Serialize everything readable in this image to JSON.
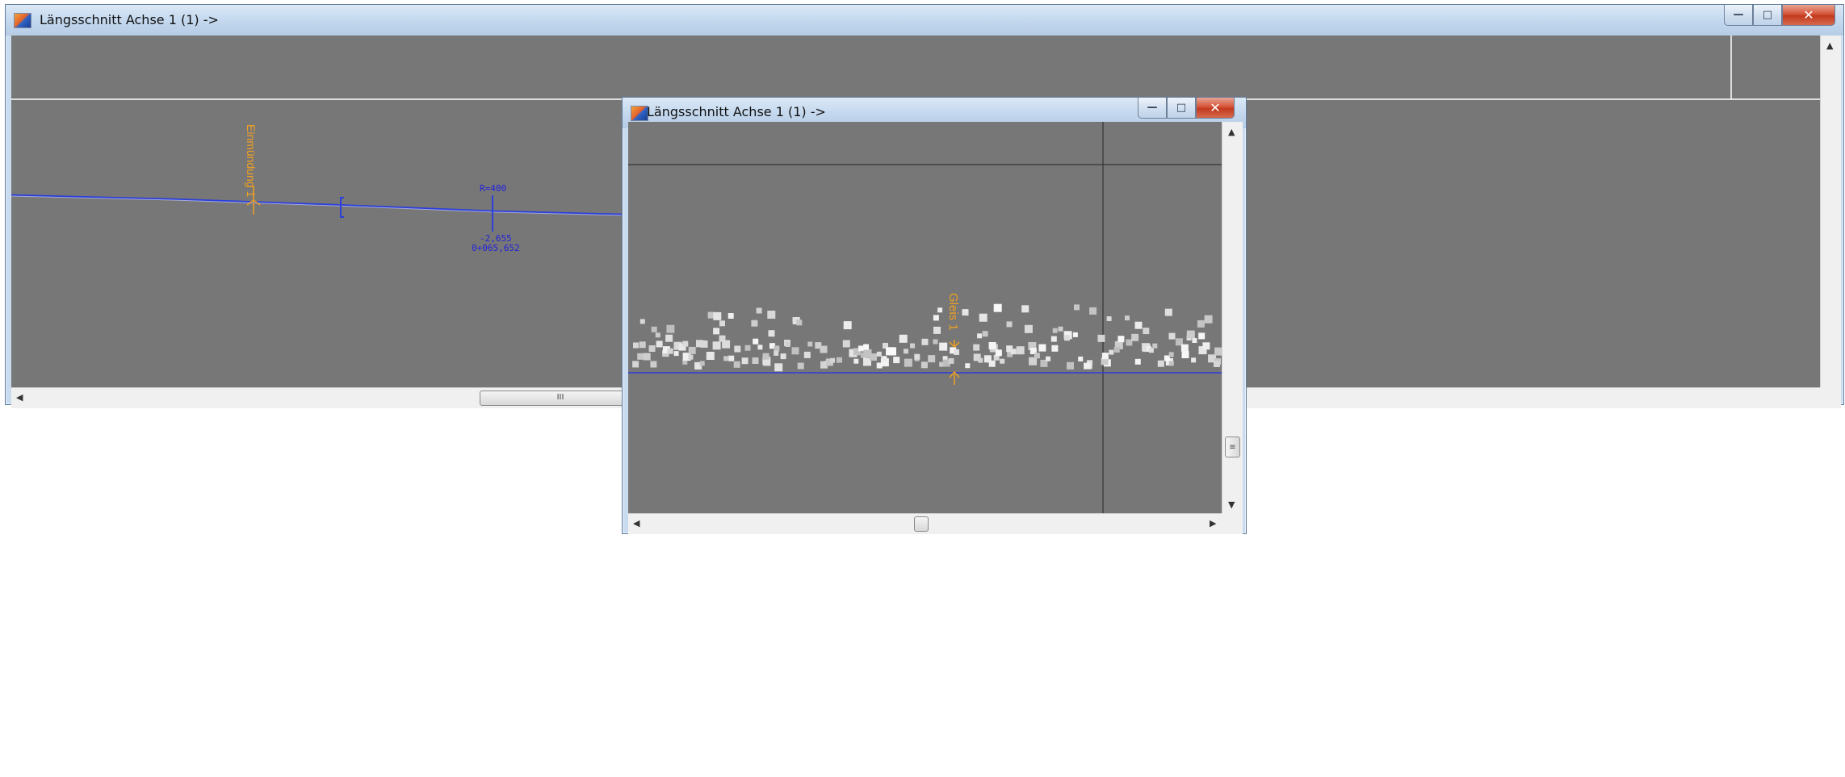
{
  "window_main": {
    "title": "Längsschnitt Achse 1 (1) ->",
    "scroll_thumb_grip": "III",
    "annotations": {
      "marker_label": "Einmündung 1",
      "station_tag": "R=400",
      "elevation_value": "-2,655",
      "station_value": "0+065,652"
    }
  },
  "window_zoom": {
    "title": "Längsschnitt Achse 1 (1) ->",
    "vertical_thumb_grip": "≡",
    "annotations": {
      "track_label": "Gleis 1"
    }
  },
  "icons": {
    "minimize": "minimize-icon",
    "maximize": "maximize-icon",
    "close": "close-icon",
    "app": "app-icon"
  },
  "colors": {
    "canvas": "#777777",
    "axis_line": "#2b3fd9",
    "annotation": "#f0a020",
    "point_cloud": "#d8d8d8"
  }
}
